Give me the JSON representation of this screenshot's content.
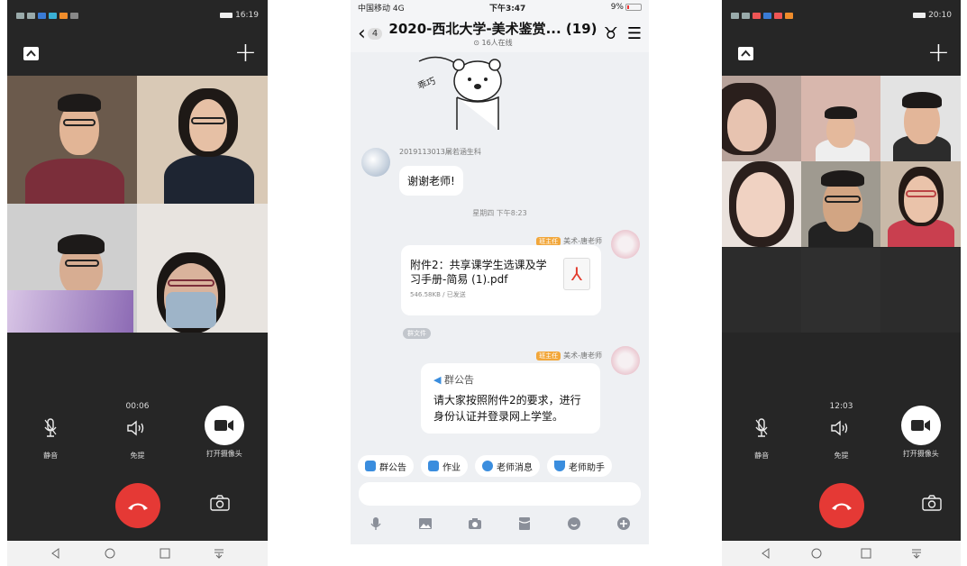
{
  "left_call": {
    "status_time": "16:19",
    "timer": "00:06",
    "mute_label": "静音",
    "speaker_label": "免提",
    "camera_label": "打开摄像头"
  },
  "chat": {
    "carrier": "中国移动 4G",
    "time": "下午3:47",
    "battery": "9%",
    "back_count": "4",
    "title": "2020-西北大学-美术鉴赏... (19)",
    "online": "16人在线",
    "sticker_text": "乖巧",
    "student_sender": "2019113013屠若涵生科",
    "student_message": "谢谢老师!",
    "timestamp": "星期四 下午8:23",
    "teacher_tag": "班主任",
    "teacher_name": "美术-唐老师",
    "file_name": "附件2：共享课学生选课及学习手册-简易 (1).pdf",
    "file_meta": "546.58KB / 已发送",
    "file_pill": "群文件",
    "notice_title": "群公告",
    "notice_text": "请大家按照附件2的要求，进行身份认证并登录网上学堂。",
    "quick": [
      "群公告",
      "作业",
      "老师消息",
      "老师助手"
    ],
    "quick_colors": [
      "#3a8dde",
      "#3a8dde",
      "#3a8dde",
      "#3a8dde"
    ]
  },
  "right_call": {
    "status_time": "20:10",
    "timer": "12:03",
    "mute_label": "静音",
    "speaker_label": "免提",
    "camera_label": "打开摄像头"
  },
  "colors": {
    "call_bg": "#262626",
    "hangup": "#e53935",
    "chat_bg": "#eef0f3",
    "teacher_tag": "#f2a73b"
  }
}
